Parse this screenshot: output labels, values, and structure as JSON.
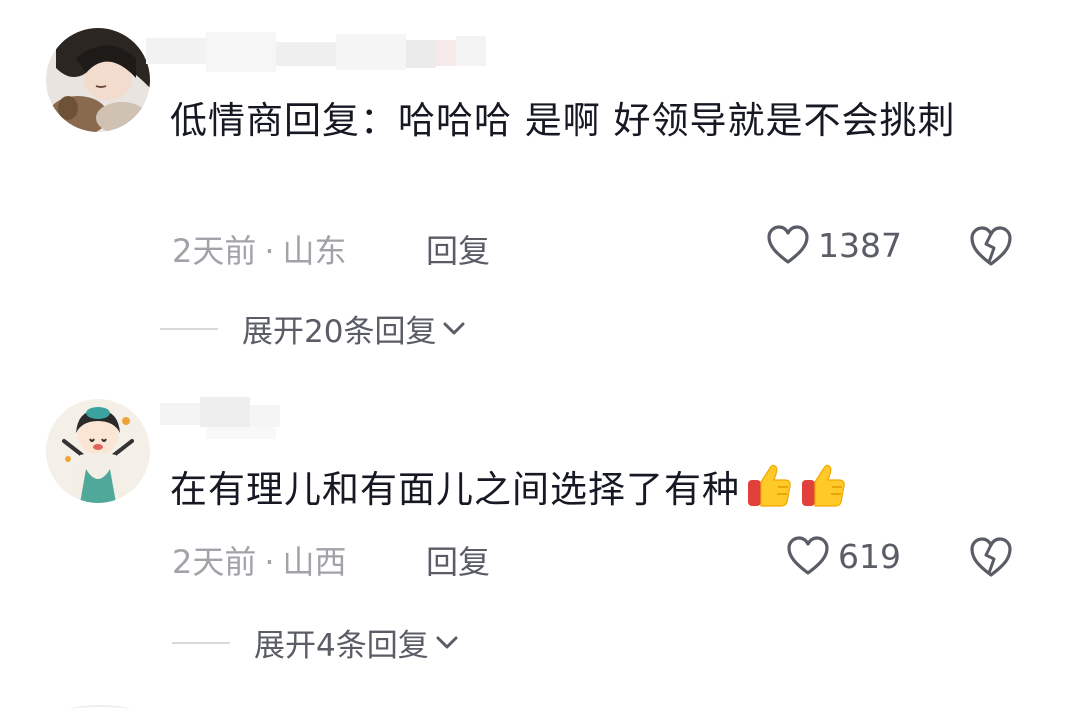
{
  "comments": [
    {
      "text": "低情商回复：哈哈哈 是啊 好领导就是不会挑刺",
      "time": "2天前",
      "separator": "·",
      "location": "山东",
      "reply_label": "回复",
      "like_count": "1387",
      "expand_label": "展开20条回复",
      "avatar_icon": "avatar-girl-photo",
      "emoji": []
    },
    {
      "text": "在有理儿和有面儿之间选择了有种",
      "time": "2天前",
      "separator": "·",
      "location": "山西",
      "reply_label": "回复",
      "like_count": "619",
      "expand_label": "展开4条回复",
      "avatar_icon": "avatar-cartoon-girl",
      "emoji": [
        "thumbs-up-emoji",
        "thumbs-up-emoji"
      ]
    }
  ],
  "icons": {
    "like": "heart-outline-icon",
    "dislike": "broken-heart-icon",
    "expand": "chevron-down-icon"
  },
  "colors": {
    "text": "#161823",
    "meta": "#a1a3a9",
    "action": "#5a5c66"
  }
}
